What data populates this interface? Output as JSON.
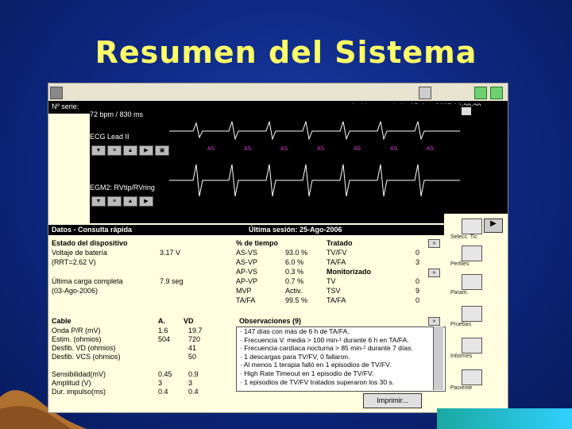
{
  "slide": {
    "title": "Resumen del Sistema"
  },
  "header": {
    "serial_label": "Nº serie:",
    "rate": "72 bpm / 830 ms",
    "date": "Archivo guardado: 1D 1 ... 2007  16:29:29"
  },
  "ecg": {
    "lead1": "ECG Lead II",
    "lead2": "EGM2: RVtip/RVring"
  },
  "rightbar": {
    "labels": [
      "Selecc. Tic",
      "Perfiles",
      "Param.",
      "Pruebas",
      "Informes",
      "Paciente"
    ]
  },
  "section": {
    "left": "Datos - Consulta rápida",
    "right": "Última sesión: 25-Ago-2006"
  },
  "device": {
    "heading": "Estado del dispositivo",
    "battery_label": "Voltaje de batería",
    "battery_value": "3.17 V",
    "rrt": "(RRT=2.62 V)",
    "charge_label": "Última carga completa",
    "charge_value": "7.9 seg",
    "charge_date": "(03-Ago-2006)"
  },
  "pacing": {
    "head_a": "% de tiempo",
    "rows": [
      {
        "k": "AS-VS",
        "v": "93.0 %"
      },
      {
        "k": "AS-VP",
        "v": "6.0 %"
      },
      {
        "k": "AP-VS",
        "v": "0.3 %"
      },
      {
        "k": "AP-VP",
        "v": "0.7 %"
      },
      {
        "k": "MVP",
        "v": "Activ."
      },
      {
        "k": "TA/FA",
        "v": "99.5 %"
      }
    ]
  },
  "events": {
    "head": "Tratado",
    "rows": [
      {
        "k": "TV/FV",
        "v": "0"
      },
      {
        "k": "TA/FA",
        "v": "3"
      },
      {
        "k": "Monitorizado",
        "v": ""
      },
      {
        "k": "TV",
        "v": "0"
      },
      {
        "k": "TSV",
        "v": "9"
      },
      {
        "k": "TA/FA",
        "v": "0"
      }
    ]
  },
  "lead_table": {
    "head": [
      "Cable",
      "A.",
      "VD"
    ],
    "rows": [
      [
        "Onda P/R (mV)",
        "1.6",
        "19.7"
      ],
      [
        "Estim. (ohmios)",
        "504",
        "720"
      ],
      [
        "Desfib. VD (ohmios)",
        "",
        "41"
      ],
      [
        "Desfib. VCS (ohmios)",
        "",
        "50"
      ],
      [
        "",
        "",
        " "
      ],
      [
        "Sensibilidad(mV)",
        "0.45",
        "0.9"
      ],
      [
        "Amplitud (V)",
        "3",
        "3"
      ],
      [
        "Dur. impulso(ms)",
        "0.4",
        "0.4"
      ]
    ]
  },
  "observations": {
    "title": "Observaciones (9)",
    "items": [
      "· 147 días con más de 6 h de TA/FA.",
      "· Frecuencia V. media > 100 min-¹ durante 6 h en TA/FA.",
      "· Frecuencia cardíaca nocturna > 85 min-¹ durante 7 días.",
      "· 1 descargas para TV/FV, 0 fallaron.",
      "· Al menos 1 terapia falló en 1 episodios de TV/FV.",
      "· High Rate Timeout en 1 episodio de TV/FV.",
      "· 1 episodios de TV/FV tratados superaron los 30 s."
    ]
  },
  "actions": {
    "print": "Imprimir..."
  }
}
